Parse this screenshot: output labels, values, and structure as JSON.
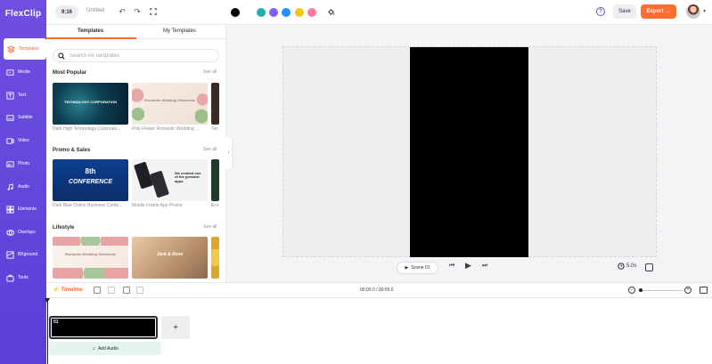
{
  "brand": {
    "logo_text": "FlexClip",
    "accent": "#6f4fe0",
    "orange": "#ff6d2f"
  },
  "sidebar": {
    "items": [
      {
        "label": "Templates",
        "icon": "templates-icon"
      },
      {
        "label": "Media",
        "icon": "media-icon"
      },
      {
        "label": "Text",
        "icon": "text-icon"
      },
      {
        "label": "Subtitle",
        "icon": "subtitle-icon"
      },
      {
        "label": "Video",
        "icon": "video-icon"
      },
      {
        "label": "Photo",
        "icon": "photo-icon"
      },
      {
        "label": "Audio",
        "icon": "audio-icon"
      },
      {
        "label": "Elements",
        "icon": "elements-icon"
      },
      {
        "label": "Overlays",
        "icon": "overlays-icon"
      },
      {
        "label": "BKground",
        "icon": "background-icon"
      },
      {
        "label": "Tools",
        "icon": "tools-icon"
      }
    ]
  },
  "topbar": {
    "ratio": "9:16",
    "title": "Untitled",
    "save": "Save",
    "export": "Export",
    "swatches": [
      "#000000",
      "#20b2aa",
      "#7b61ff",
      "#1e90ff",
      "#f5c518",
      "#ff7a9c"
    ]
  },
  "panel": {
    "tabs": [
      "Templates",
      "My Templates"
    ],
    "search_placeholder": "Search All Templates",
    "sections": [
      {
        "title": "Most Popular",
        "see_all": "See all",
        "items": [
          "Dark High Technology Corporate...",
          "Pink Flower Romantic Wedding ...",
          "Tec"
        ],
        "thumb_texts": [
          "TECHNOLOGY CORPORATION",
          "Romantic Wedding Slideshow"
        ]
      },
      {
        "title": "Promo & Sales",
        "see_all": "See all",
        "items": [
          "Dark Blue Online Business Confe...",
          "Mobile Frame App Promo",
          "Eco"
        ],
        "thumb_texts": [
          "8th",
          "CONFERENCE",
          "We created one of the greatest apps."
        ]
      },
      {
        "title": "Lifestyle",
        "see_all": "See all",
        "items": [
          "",
          "",
          ""
        ],
        "thumb_texts": [
          "Romantic Wedding Slideshow",
          "Jack & Rose"
        ]
      }
    ]
  },
  "player": {
    "scene_label": "Scene 01",
    "duration": "5.0s"
  },
  "timeline": {
    "label": "Timeline",
    "time": "00:00.0 / 00:05.0",
    "clip_number": "01",
    "add_audio": "Add Audio",
    "add_scene": "+"
  }
}
